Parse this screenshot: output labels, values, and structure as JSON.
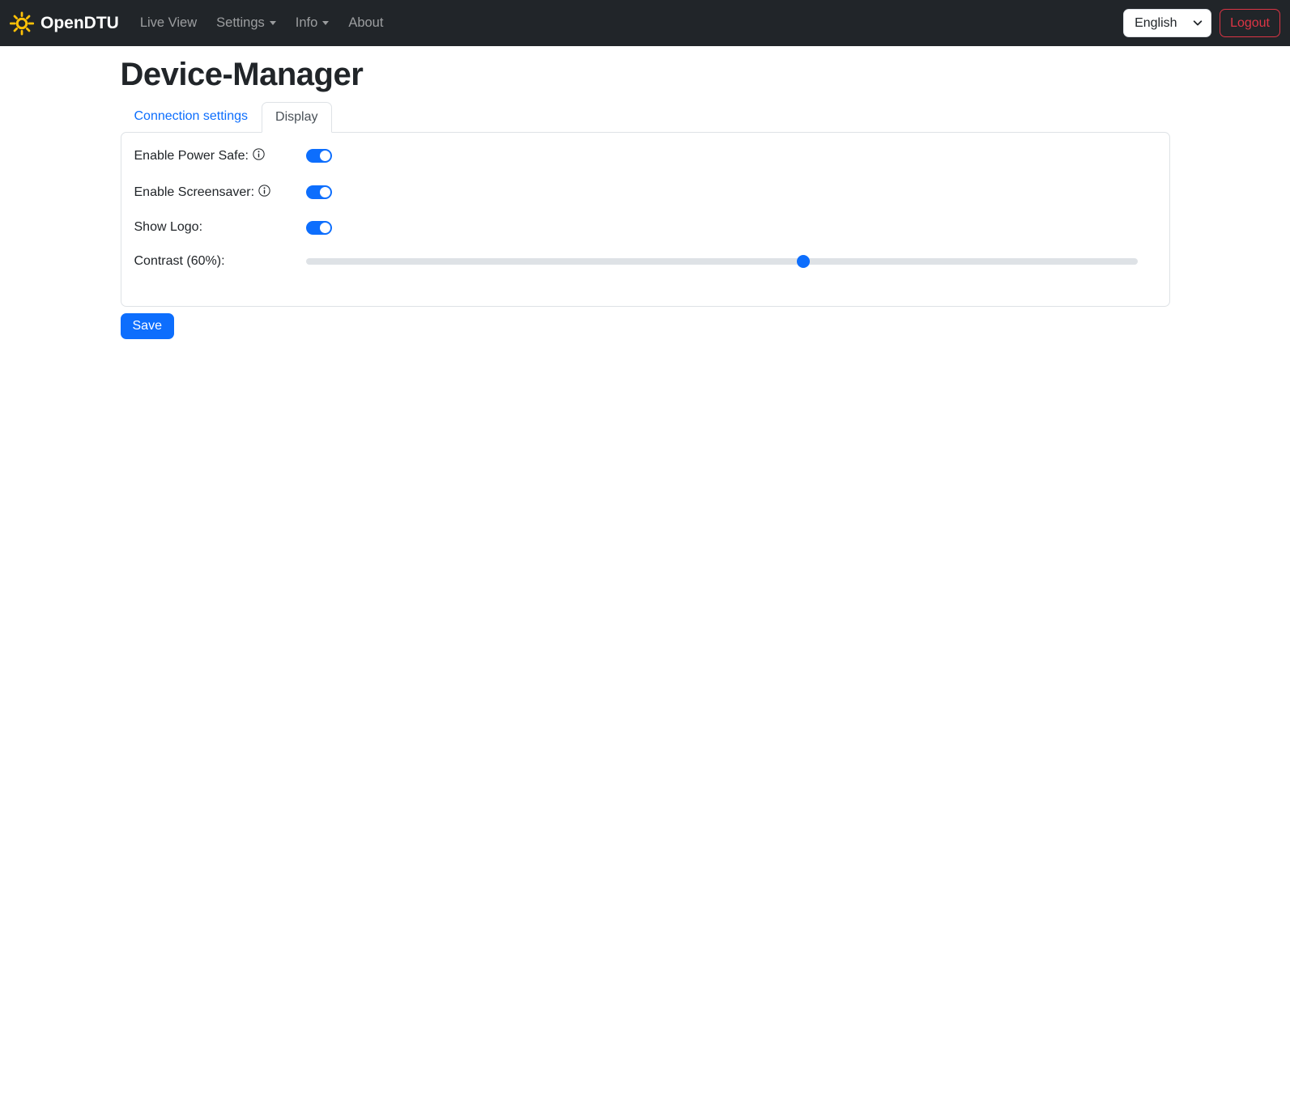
{
  "navbar": {
    "brand": "OpenDTU",
    "items": [
      {
        "label": "Live View",
        "has_caret": false
      },
      {
        "label": "Settings",
        "has_caret": true
      },
      {
        "label": "Info",
        "has_caret": true
      },
      {
        "label": "About",
        "has_caret": false
      }
    ],
    "language_selected": "English",
    "logout_label": "Logout"
  },
  "page": {
    "title": "Device-Manager"
  },
  "tabs": [
    {
      "label": "Connection settings",
      "active": false
    },
    {
      "label": "Display",
      "active": true
    }
  ],
  "form": {
    "rows": [
      {
        "label": "Enable Power Safe:",
        "has_info": true,
        "type": "toggle",
        "value": true
      },
      {
        "label": "Enable Screensaver:",
        "has_info": true,
        "type": "toggle",
        "value": true
      },
      {
        "label": "Show Logo:",
        "has_info": false,
        "type": "toggle",
        "value": true
      },
      {
        "label": "Contrast (60%):",
        "has_info": false,
        "type": "slider"
      }
    ],
    "contrast_percent": 60,
    "save_label": "Save"
  },
  "icons": {
    "brand": "sun-icon",
    "nav_dropdown": "caret-down-icon",
    "language": "chevron-down-icon",
    "field_help": "info-circle-icon"
  },
  "colors": {
    "accent": "#0d6efd",
    "navbar_bg": "#212529",
    "danger": "#dc3545",
    "brand_icon": "#ffc107",
    "card_border": "#dee2e6",
    "slider_track": "#dee2e6",
    "nav_link": "rgba(255,255,255,0.55)"
  }
}
